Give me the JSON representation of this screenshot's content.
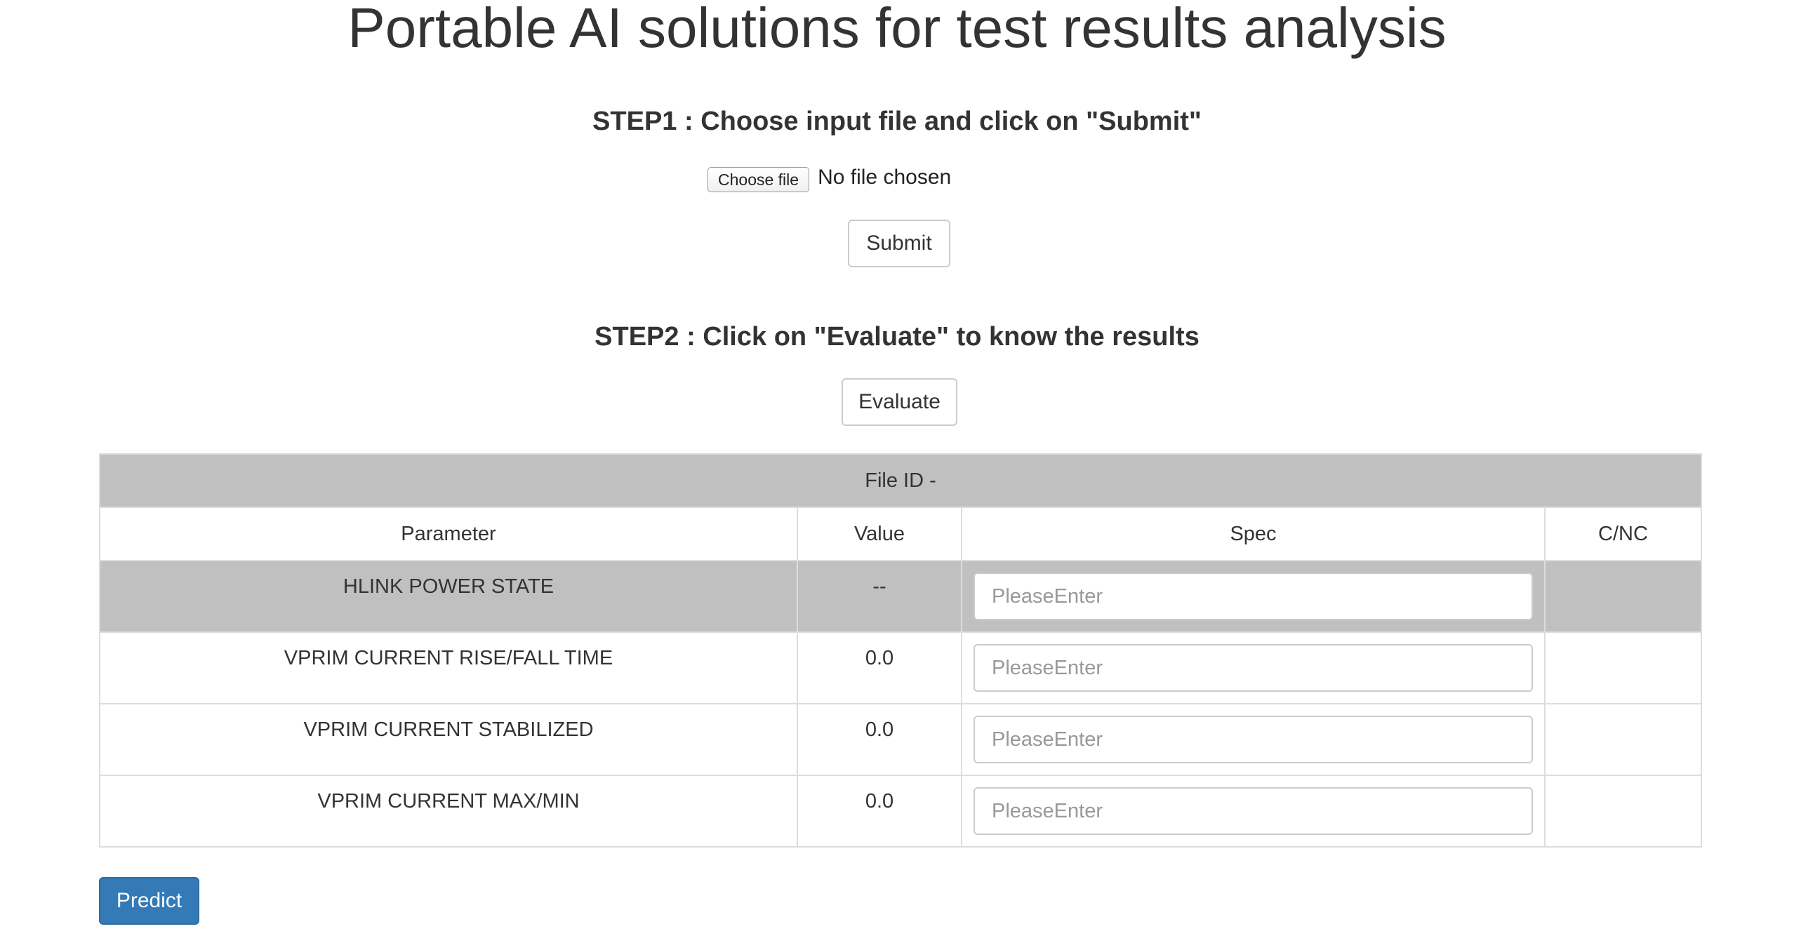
{
  "page": {
    "title": "Portable AI solutions for test results analysis"
  },
  "step1": {
    "heading": "STEP1 : Choose input file and click on \"Submit\"",
    "choose_file_label": "Choose file",
    "file_status": "No file chosen",
    "submit_label": "Submit"
  },
  "step2": {
    "heading": "STEP2 : Click on \"Evaluate\" to know the results",
    "evaluate_label": "Evaluate"
  },
  "table": {
    "file_id_header": "File ID -",
    "columns": [
      "Parameter",
      "Value",
      "Spec",
      "C/NC"
    ],
    "rows": [
      {
        "parameter": "HLINK POWER STATE",
        "value": "--",
        "spec_placeholder": "PleaseEnter",
        "cnc": ""
      },
      {
        "parameter": "VPRIM CURRENT RISE/FALL TIME",
        "value": "0.0",
        "spec_placeholder": "PleaseEnter",
        "cnc": ""
      },
      {
        "parameter": "VPRIM CURRENT STABILIZED",
        "value": "0.0",
        "spec_placeholder": "PleaseEnter",
        "cnc": ""
      },
      {
        "parameter": "VPRIM CURRENT MAX/MIN",
        "value": "0.0",
        "spec_placeholder": "PleaseEnter",
        "cnc": ""
      }
    ]
  },
  "predict_label": "Predict",
  "colors": {
    "primary": "#337ab7",
    "header_gray": "#c0c0c0",
    "border": "#dddddd"
  }
}
